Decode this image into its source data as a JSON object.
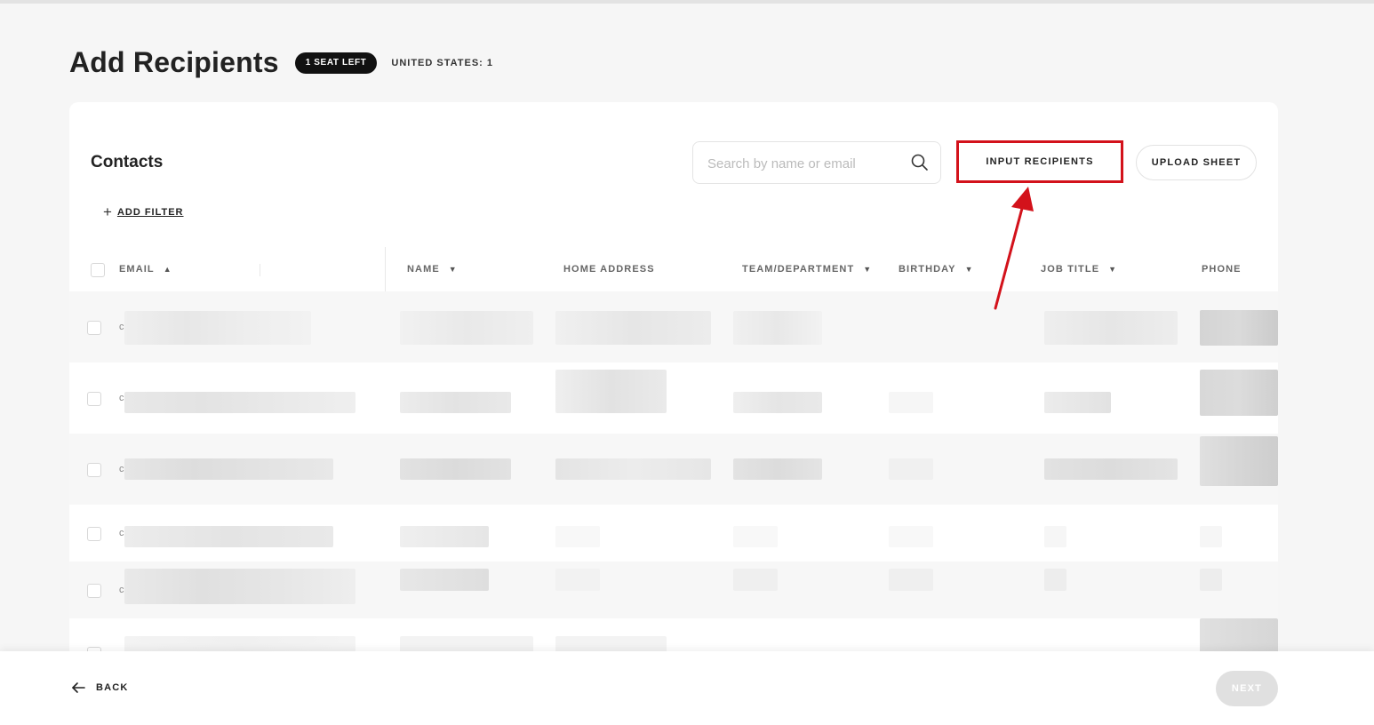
{
  "header": {
    "title": "Add Recipients",
    "seat_badge": "1 SEAT LEFT",
    "country_count": "UNITED STATES: 1"
  },
  "contacts": {
    "title": "Contacts",
    "search_placeholder": "Search by name or email",
    "input_recipients_label": "INPUT RECIPIENTS",
    "upload_sheet_label": "UPLOAD SHEET",
    "add_filter_label": "ADD FILTER"
  },
  "table": {
    "columns": [
      {
        "label": "EMAIL",
        "sort": "asc"
      },
      {
        "label": "NAME",
        "sort": "dropdown"
      },
      {
        "label": "HOME ADDRESS",
        "sort": ""
      },
      {
        "label": "TEAM/DEPARTMENT",
        "sort": "dropdown"
      },
      {
        "label": "BIRTHDAY",
        "sort": "dropdown"
      },
      {
        "label": "JOB TITLE",
        "sort": "dropdown"
      },
      {
        "label": "PHONE",
        "sort": ""
      }
    ],
    "row_initials": [
      "c",
      "c",
      "c",
      "c",
      "c"
    ]
  },
  "footer": {
    "back_label": "BACK",
    "next_label": "NEXT"
  },
  "colors": {
    "highlight": "#d3121b",
    "badge_bg": "#111111",
    "next_disabled": "#e0e0e0"
  },
  "icons": {
    "search": "search-icon",
    "sort_asc": "caret-up-icon",
    "sort_dropdown": "caret-down-icon",
    "add": "plus-icon",
    "back": "arrow-left-icon",
    "annotation": "red-arrow-icon"
  }
}
